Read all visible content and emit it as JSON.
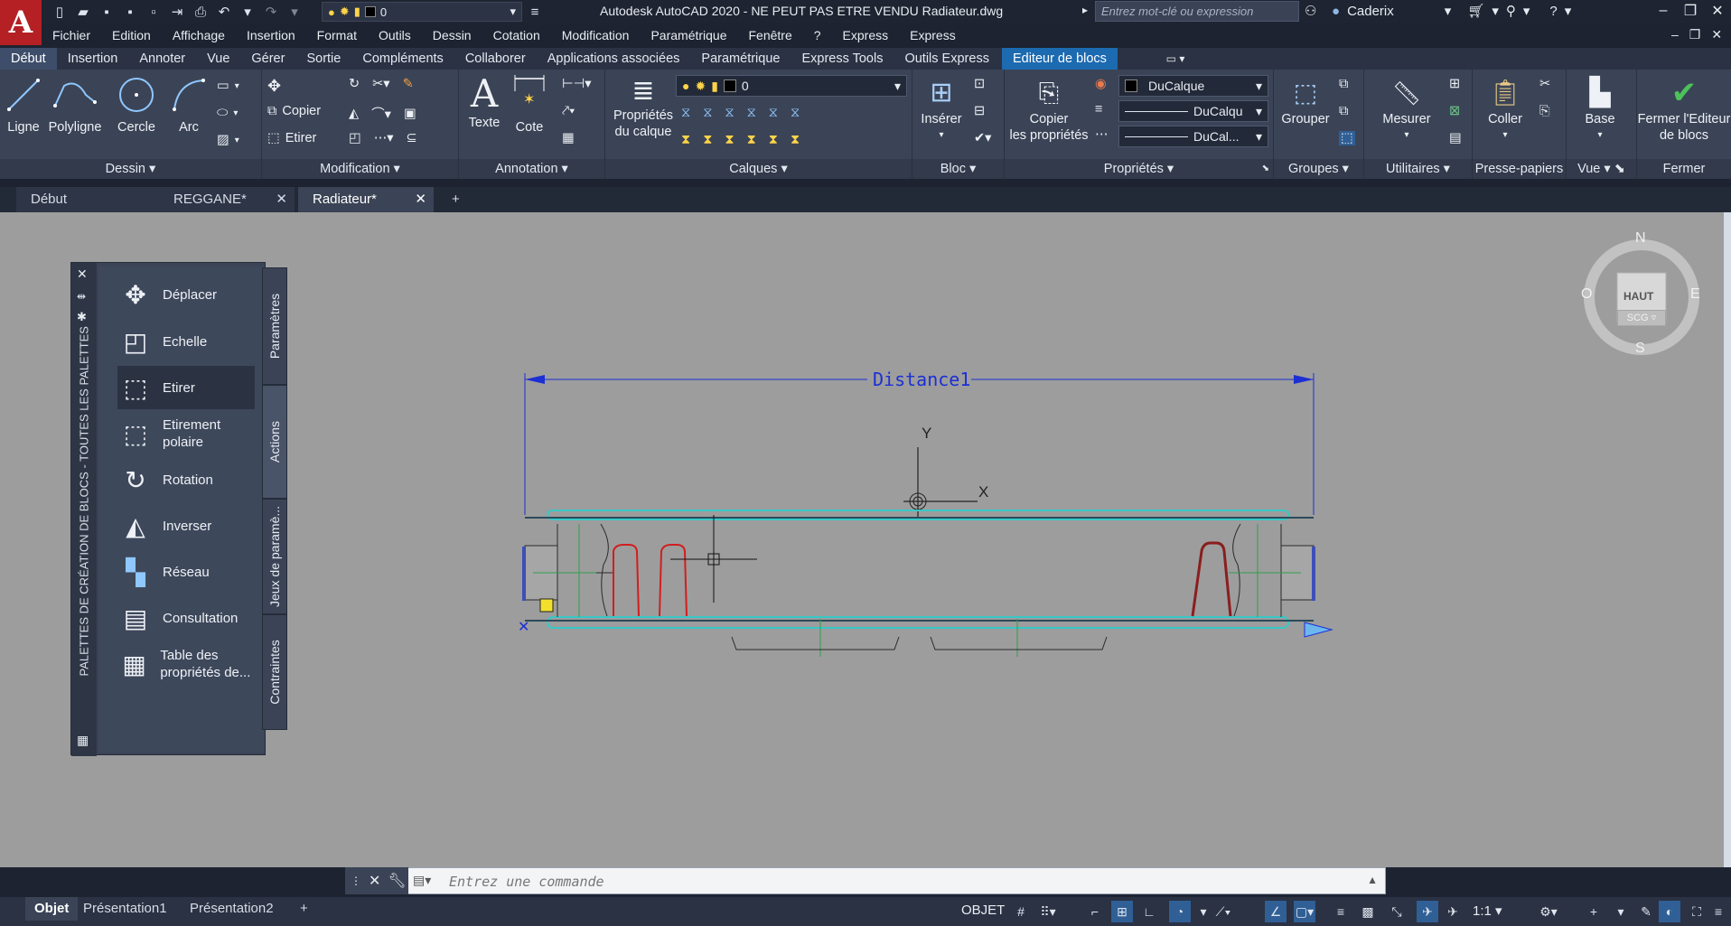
{
  "window": {
    "title": "Autodesk AutoCAD 2020 - NE PEUT PAS ETRE VENDU    Radiateur.dwg",
    "search_placeholder": "Entrez mot-clé ou expression",
    "user": "Caderix",
    "quick_layer": "0",
    "logo": "A"
  },
  "menu": [
    "Fichier",
    "Edition",
    "Affichage",
    "Insertion",
    "Format",
    "Outils",
    "Dessin",
    "Cotation",
    "Modification",
    "Paramétrique",
    "Fenêtre",
    "?",
    "Express",
    "Express"
  ],
  "ribbon_tabs": [
    "Début",
    "Insertion",
    "Annoter",
    "Vue",
    "Gérer",
    "Sortie",
    "Compléments",
    "Collaborer",
    "Applications associées",
    "Paramétrique",
    "Express Tools",
    "Outils Express",
    "Editeur de blocs"
  ],
  "ribbon": {
    "dessin": {
      "title": "Dessin",
      "ligne": "Ligne",
      "polyligne": "Polyligne",
      "cercle": "Cercle",
      "arc": "Arc"
    },
    "modification": {
      "title": "Modification",
      "copier": "Copier",
      "etirer": "Etirer"
    },
    "annotation": {
      "title": "Annotation",
      "texte": "Texte",
      "cote": "Cote"
    },
    "calques": {
      "title": "Calques",
      "proprietes_l1": "Propriétés",
      "proprietes_l2": "du calque",
      "layer_value": "0"
    },
    "bloc": {
      "title": "Bloc",
      "inserer": "Insérer"
    },
    "proprietes": {
      "title": "Propriétés",
      "copier_l1": "Copier",
      "copier_l2": "les propriétés",
      "color": "DuCalque",
      "linetype": "DuCalqu",
      "lineweight": "DuCal..."
    },
    "groupes": {
      "title": "Groupes",
      "grouper": "Grouper"
    },
    "utilitaires": {
      "title": "Utilitaires",
      "mesurer": "Mesurer"
    },
    "pressepapiers": {
      "title": "Presse-papiers",
      "coller": "Coller"
    },
    "vue": {
      "title": "Vue",
      "base": "Base"
    },
    "fermer": {
      "title": "Fermer",
      "fermer_l1": "Fermer l'Editeur",
      "fermer_l2": "de blocs"
    }
  },
  "doc_tabs": [
    "Début",
    "REGGANE*",
    "Radiateur*"
  ],
  "palette": {
    "vertical_title": "PALETTES DE CRÉATION DE BLOCS - TOUTES LES PALETTES",
    "items": [
      {
        "label": "Déplacer"
      },
      {
        "label": "Echelle"
      },
      {
        "label": "Etirer"
      },
      {
        "label": "Etirement polaire"
      },
      {
        "label": "Rotation"
      },
      {
        "label": "Inverser"
      },
      {
        "label": "Réseau"
      },
      {
        "label": "Consultation"
      },
      {
        "label": "Table des propriétés de..."
      }
    ],
    "tabs": [
      "Paramètres",
      "Actions",
      "Jeux de paramè...",
      "Contraintes"
    ]
  },
  "drawing": {
    "parameter_label": "Distance1",
    "axis_y": "Y",
    "axis_x": "X"
  },
  "viewcube": {
    "n": "N",
    "s": "S",
    "e": "E",
    "o": "O",
    "face": "HAUT",
    "ucs": "SCG"
  },
  "command": {
    "placeholder": "Entrez une commande"
  },
  "layout_tabs": [
    "Objet",
    "Présentation1",
    "Présentation2"
  ],
  "status": {
    "mode": "OBJET",
    "scale": "1:1"
  }
}
